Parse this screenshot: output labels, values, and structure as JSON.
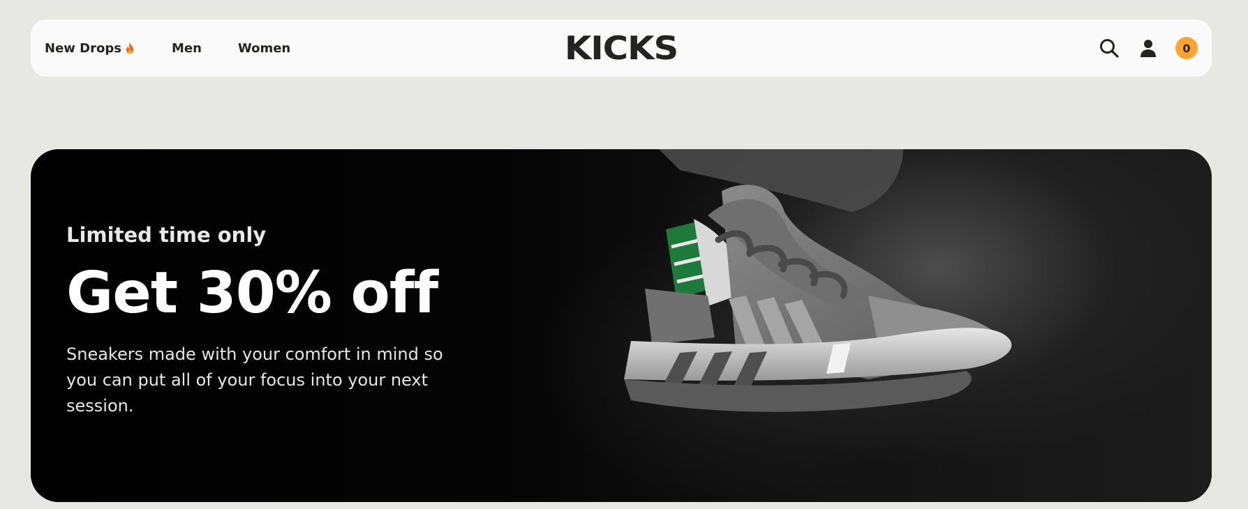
{
  "nav": {
    "links": [
      {
        "label": "New Drops",
        "icon": "fire-icon"
      },
      {
        "label": "Men"
      },
      {
        "label": "Women"
      }
    ],
    "logo": "KICKS",
    "cart_count": "0",
    "accent_color": "#ffa52f"
  },
  "hero": {
    "eyebrow": "Limited time only",
    "headline": "Get 30% off",
    "subcopy": "Sneakers made with your comfort in mind so you can put all of your focus into your next session.",
    "image": "grey-sneaker-photo"
  }
}
